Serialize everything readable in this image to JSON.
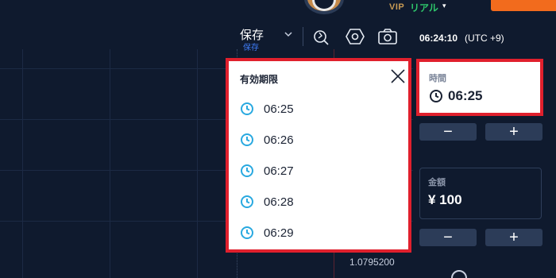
{
  "header": {
    "account_tier": "VIP",
    "account_type": "リアル",
    "account_caret": "▾",
    "save_label": "保存",
    "save_sublabel": "保存",
    "server_time": "06:24:10",
    "timezone": "(UTC +9)",
    "tools": [
      "drawing-tools-icon",
      "settings-hexagon-icon",
      "screenshot-camera-icon"
    ]
  },
  "chart": {
    "price_label": "1.0795200"
  },
  "expiry_dropdown": {
    "title": "有効期限",
    "options": [
      "06:25",
      "06:26",
      "06:27",
      "06:28",
      "06:29"
    ]
  },
  "trade_panel": {
    "time_label": "時間",
    "time_value": "06:25",
    "amount_label": "金額",
    "amount_value": "¥ 100",
    "minus": "−",
    "plus": "+"
  },
  "colors": {
    "background": "#0f1a2e",
    "highlight_border": "#e0202d",
    "accent_clock": "#29a9e0",
    "real_green": "#2ec76b",
    "save_blue": "#3f7cf6",
    "button_bg": "#2c3c58",
    "orange": "#f26b1d"
  }
}
